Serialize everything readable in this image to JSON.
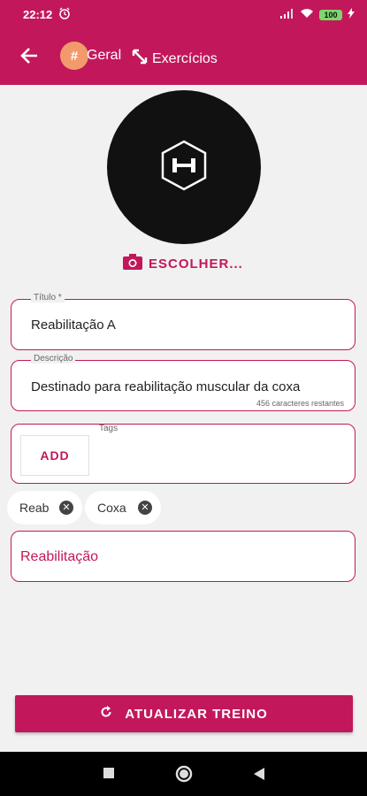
{
  "status": {
    "time": "22:12",
    "alarm_icon": "alarm-icon",
    "battery": "100"
  },
  "appbar": {
    "tab_geral": "Geral",
    "tab_geral_hash": "#",
    "tab_exercicios": "Exercícios",
    "accent": "#c2185b"
  },
  "photo": {
    "choose_label": "ESCOLHER..."
  },
  "form": {
    "titulo": {
      "label": "Título *",
      "value": "Reabilitação A"
    },
    "descricao": {
      "label": "Descrição",
      "value": "Destinado para reabilitação muscular da coxa",
      "counter": "456 caracteres restantes"
    },
    "tags": {
      "label": "Tags",
      "add_label": "ADD",
      "items": [
        {
          "label": "Reab"
        },
        {
          "label": "Coxa"
        }
      ]
    },
    "categoria": {
      "value": "Reabilitação"
    }
  },
  "actions": {
    "update_label": "ATUALIZAR TREINO"
  }
}
